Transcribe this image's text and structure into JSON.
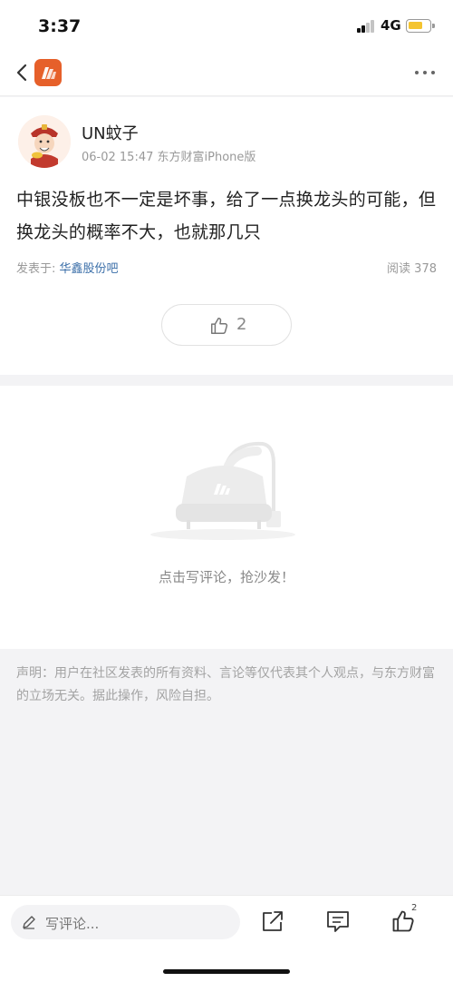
{
  "status_bar": {
    "time": "3:37",
    "network": "4G",
    "battery_color": "#f4c430"
  },
  "nav": {
    "back_icon": "chevron-left-icon",
    "logo_icon": "eastmoney-logo-icon",
    "more_icon": "more-dots-icon",
    "logo_color": "#e6602a"
  },
  "post": {
    "username": "UN蚊子",
    "meta": "06-02 15:47 东方财富iPhone版",
    "body": "中银没板也不一定是坏事，给了一点换龙头的可能，但换龙头的概率不大，也就那几只",
    "posted_in_label": "发表于: ",
    "forum_name": "华鑫股份吧",
    "read_count": "阅读 378",
    "like_count": "2"
  },
  "comments": {
    "empty_text": "点击写评论，抢沙发！"
  },
  "disclaimer": "声明：用户在社区发表的所有资料、言论等仅代表其个人观点，与东方财富的立场无关。据此操作，风险自担。",
  "bottom_bar": {
    "comment_placeholder": "写评论...",
    "share_icon": "share-icon",
    "comment_icon": "comment-icon",
    "like_icon": "thumbs-up-icon",
    "like_count": "2"
  }
}
